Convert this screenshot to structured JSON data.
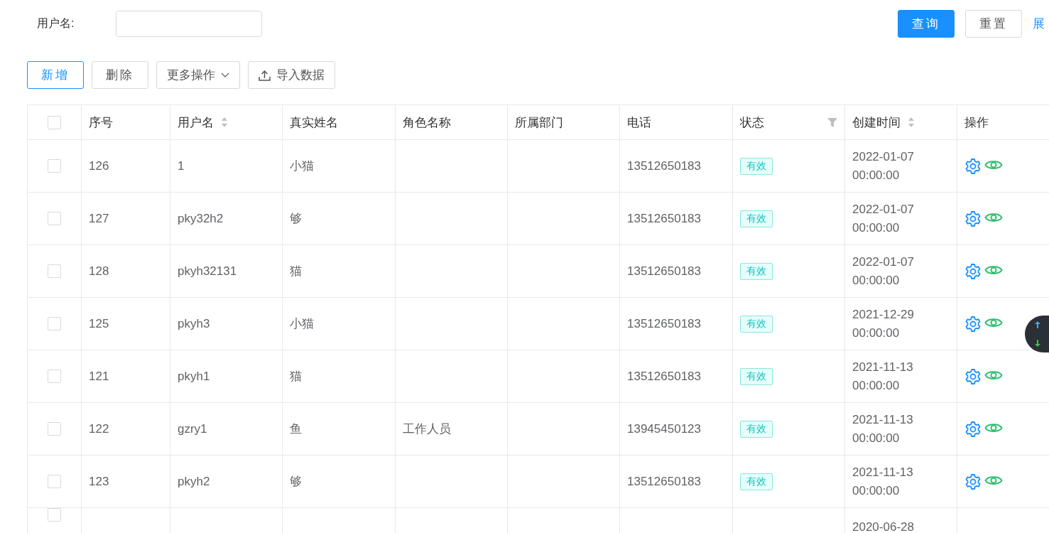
{
  "search": {
    "label": "用户名:",
    "query_button": "查询",
    "reset_button": "重置",
    "expand_link": "展"
  },
  "toolbar": [
    {
      "label": "新增",
      "kind": "primary"
    },
    {
      "label": "删除",
      "kind": "plain"
    },
    {
      "label": "更多操作",
      "kind": "dropdown"
    },
    {
      "label": "导入数据",
      "kind": "upload"
    }
  ],
  "table": {
    "header_checked": false,
    "columns": [
      {
        "label": "序号",
        "kind": "plain"
      },
      {
        "label": "用户名",
        "kind": "sort"
      },
      {
        "label": "真实姓名",
        "kind": "plain"
      },
      {
        "label": "角色名称",
        "kind": "plain"
      },
      {
        "label": "所属部门",
        "kind": "plain"
      },
      {
        "label": "电话",
        "kind": "plain"
      },
      {
        "label": "状态",
        "kind": "filter"
      },
      {
        "label": "创建时间",
        "kind": "sort"
      },
      {
        "label": "操作",
        "kind": "plain"
      }
    ],
    "rows": [
      {
        "checked": false,
        "seq": "126",
        "username": "1",
        "real_name": "小猫",
        "phone": "13512650183",
        "status": "有效",
        "created": "2022-01-07 00:00:00"
      },
      {
        "checked": false,
        "seq": "127",
        "username": "pky32h2",
        "real_name": "够",
        "phone": "13512650183",
        "status": "有效",
        "created": "2022-01-07 00:00:00"
      },
      {
        "checked": false,
        "seq": "128",
        "username": "pkyh32131",
        "real_name": "猫",
        "phone": "13512650183",
        "status": "有效",
        "created": "2022-01-07 00:00:00"
      },
      {
        "checked": false,
        "seq": "125",
        "username": "pkyh3",
        "real_name": "小猫",
        "phone": "13512650183",
        "status": "有效",
        "created": "2021-12-29 00:00:00"
      },
      {
        "checked": false,
        "seq": "121",
        "username": "pkyh1",
        "real_name": "猫",
        "phone": "13512650183",
        "status": "有效",
        "created": "2021-11-13 00:00:00"
      },
      {
        "checked": false,
        "seq": "122",
        "username": "gzry1",
        "real_name": "鱼",
        "role": "工作人员",
        "phone": "13945450123",
        "status": "有效",
        "created": "2021-11-13 00:00:00"
      },
      {
        "checked": false,
        "seq": "123",
        "username": "pkyh2",
        "real_name": "够",
        "phone": "13512650183",
        "status": "有效",
        "created": "2021-11-13 00:00:00"
      },
      {
        "checked": false,
        "created": "2020-06-28"
      }
    ]
  }
}
